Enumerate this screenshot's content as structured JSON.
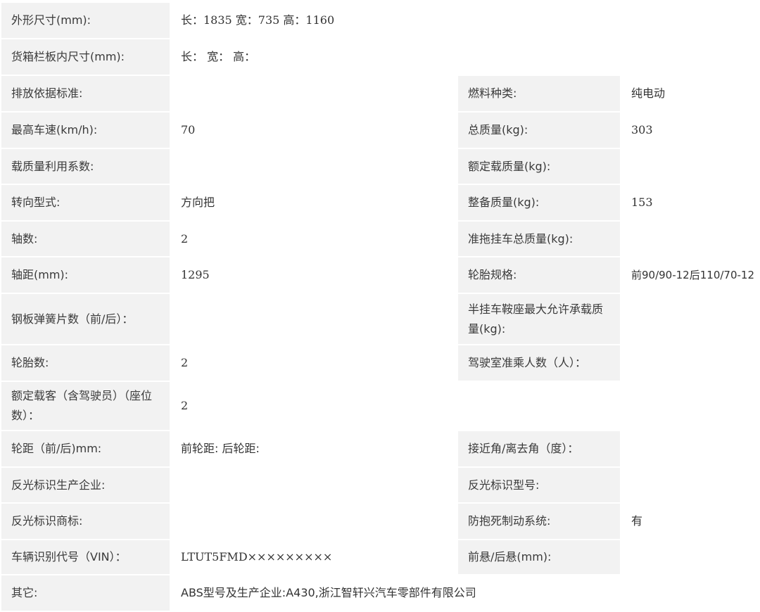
{
  "rows": [
    {
      "l1": "外形尺寸(mm):",
      "v1": "长：1835 宽：735 高：1160",
      "wide": true
    },
    {
      "l1": "货箱栏板内尺寸(mm):",
      "v1": "长： 宽： 高：",
      "wide": true
    },
    {
      "l1": "排放依据标准:",
      "v1": "",
      "l2": "燃料种类:",
      "v2": "纯电动"
    },
    {
      "l1": "最高车速(km/h):",
      "v1": "70",
      "l2": "总质量(kg):",
      "v2": "303"
    },
    {
      "l1": "载质量利用系数:",
      "v1": "",
      "l2": "额定载质量(kg):",
      "v2": ""
    },
    {
      "l1": "转向型式:",
      "v1": "方向把",
      "l2": "整备质量(kg):",
      "v2": "153"
    },
    {
      "l1": "轴数:",
      "v1": "2",
      "l2": "准拖挂车总质量(kg):",
      "v2": ""
    },
    {
      "l1": "轴距(mm):",
      "v1": "1295",
      "l2": "轮胎规格:",
      "v2": "前90/90-12后110/70-12"
    },
    {
      "l1": "钢板弹簧片数（前/后）：",
      "v1": "",
      "l2": "半挂车鞍座最大允许承载质量(kg):",
      "v2": ""
    },
    {
      "l1": "轮胎数:",
      "v1": "2",
      "l2": "驾驶室准乘人数（人）：",
      "v2": ""
    },
    {
      "l1": "额定载客（含驾驶员）（座位数）：",
      "v1": "2",
      "wide": true
    },
    {
      "l1": "轮距（前/后)mm:",
      "v1": "前轮距: 后轮距:",
      "l2": "接近角/离去角（度）：",
      "v2": ""
    },
    {
      "l1": "反光标识生产企业:",
      "v1": "",
      "l2": "反光标识型号:",
      "v2": ""
    },
    {
      "l1": "反光标识商标:",
      "v1": "",
      "l2": "防抱死制动系统:",
      "v2": "有"
    },
    {
      "l1": "车辆识别代号（VIN）：",
      "v1": "LTUT5FMD×××××××××",
      "l2": "前悬/后悬(mm):",
      "v2": ""
    },
    {
      "l1": "其它:",
      "v1": "ABS型号及生产企业:A430,浙江智轩兴汽车零部件有限公司",
      "wide": true
    }
  ]
}
